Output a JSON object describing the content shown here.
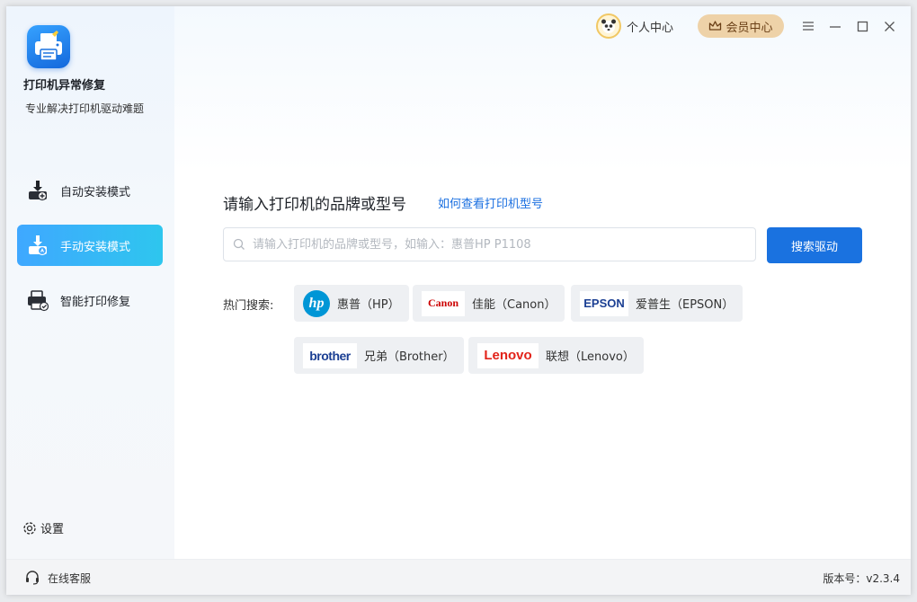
{
  "app": {
    "title": "打印机异常修复",
    "subtitle": "专业解决打印机驱动难题"
  },
  "sidebar": {
    "items": [
      {
        "label": "自动安装模式",
        "icon": "auto-install-icon",
        "active": false
      },
      {
        "label": "手动安装模式",
        "icon": "manual-install-icon",
        "active": true
      },
      {
        "label": "智能打印修复",
        "icon": "smart-repair-icon",
        "active": false
      }
    ],
    "settings_label": "设置"
  },
  "topbar": {
    "user_center": "个人中心",
    "vip_center": "会员中心"
  },
  "search": {
    "heading": "请输入打印机的品牌或型号",
    "howto_link": "如何查看打印机型号",
    "placeholder": "请输入打印机的品牌或型号，如输入：惠普HP P1108",
    "value": "",
    "button": "搜索驱动"
  },
  "hot": {
    "label": "热门搜索:",
    "brands": [
      {
        "logo": "hp",
        "label": "惠普（HP）"
      },
      {
        "logo": "Canon",
        "label": "佳能（Canon）"
      },
      {
        "logo": "EPSON",
        "label": "爱普生（EPSON）"
      },
      {
        "logo": "brother",
        "label": "兄弟（Brother）"
      },
      {
        "logo": "Lenovo",
        "label": "联想（Lenovo）"
      }
    ]
  },
  "footer": {
    "service": "在线客服",
    "version": "版本号：v2.3.4"
  },
  "colors": {
    "accent": "#1a72e0",
    "nav_active_start": "#3fa8ff",
    "nav_active_end": "#2ec6ee",
    "vip_bg": "#eed2a8",
    "canon_red": "#cc0000",
    "epson_blue": "#1b3f93",
    "lenovo_red": "#e2231a",
    "hp_blue": "#0096d6"
  }
}
